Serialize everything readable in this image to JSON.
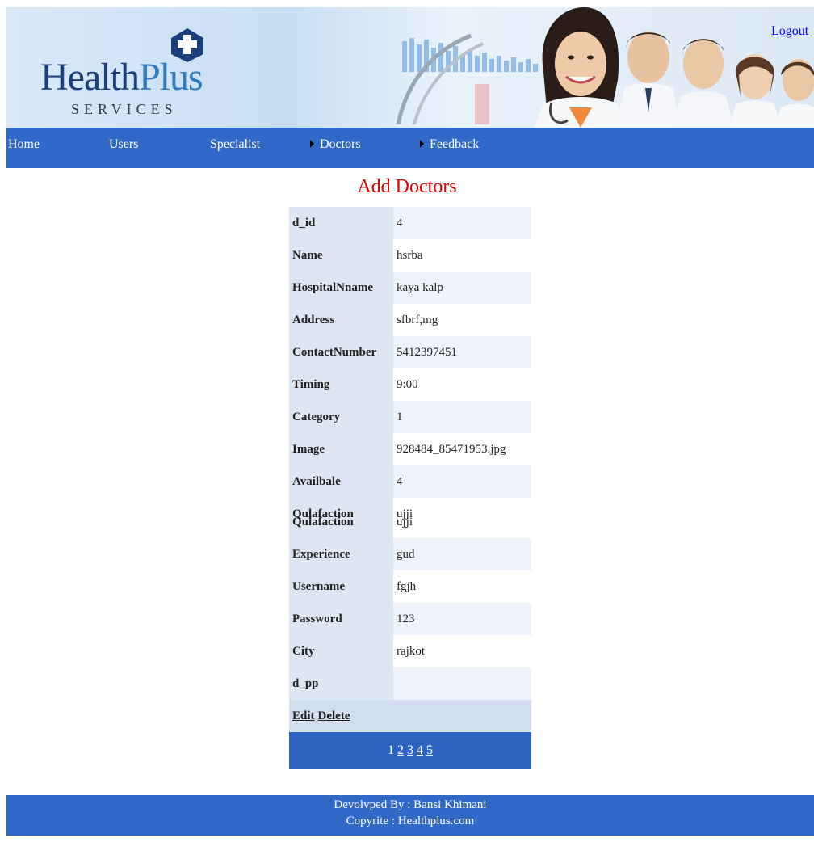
{
  "header": {
    "logo_word1": "Health",
    "logo_word2": "Plus",
    "logo_sub": "SERVICES",
    "logout_label": "Logout"
  },
  "nav": {
    "items": [
      {
        "label": "Home"
      },
      {
        "label": "Users"
      },
      {
        "label": "Specialist"
      },
      {
        "label": "Doctors"
      },
      {
        "label": "Feedback"
      }
    ]
  },
  "page_title": "Add Doctors",
  "record": {
    "rows": [
      {
        "label": "d_id",
        "value": "4"
      },
      {
        "label": "Name",
        "value": "hsrba"
      },
      {
        "label": "HospitalNname",
        "value": "kaya kalp"
      },
      {
        "label": "Address",
        "value": "sfbrf,mg"
      },
      {
        "label": "ContactNumber",
        "value": "5412397451"
      },
      {
        "label": "Timing",
        "value": "9:00"
      },
      {
        "label": "Category",
        "value": "1"
      },
      {
        "label": "Image",
        "value": "928484_85471953.jpg"
      },
      {
        "label": "Availbale",
        "value": "4"
      },
      {
        "label": "Qulafaction",
        "value": "ujji"
      },
      {
        "label": "Experience",
        "value": "gud"
      },
      {
        "label": "Username",
        "value": "fgjh"
      },
      {
        "label": "Password",
        "value": "123"
      },
      {
        "label": "City",
        "value": "rajkot"
      },
      {
        "label": "d_pp",
        "value": ""
      }
    ],
    "actions": {
      "edit": "Edit",
      "delete": "Delete"
    }
  },
  "pager": {
    "current": "1",
    "links": [
      "2",
      "3",
      "4",
      "5"
    ]
  },
  "footer": {
    "line1": "Devolvped By : Bansi Khimani",
    "line2": "Copyrite : Healthplus.com"
  },
  "colors": {
    "nav_bg": "#3169c9",
    "title": "#e00000",
    "label_bg": "#dde6f3",
    "alt_val_bg": "#eef3fc",
    "pager_bg": "#2c63c0"
  }
}
